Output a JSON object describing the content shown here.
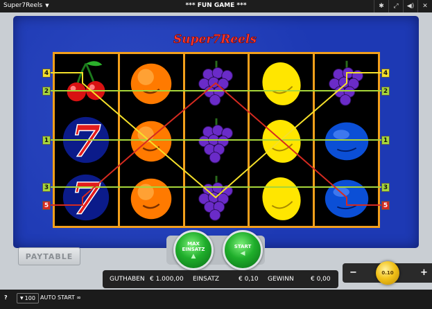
{
  "topbar": {
    "game_name": "Super7Reels",
    "mode": "*** FUN GAME ***",
    "icons": [
      "gear-icon",
      "fullscreen-icon",
      "sound-icon",
      "close-icon"
    ]
  },
  "logo": {
    "text": "Super7Reels"
  },
  "reels": [
    [
      "cherry",
      "seven",
      "seven"
    ],
    [
      "orange",
      "orange",
      "orange"
    ],
    [
      "grapes",
      "grapes",
      "grapes"
    ],
    [
      "lemon",
      "lemon",
      "lemon"
    ],
    [
      "grapes",
      "plum",
      "plum"
    ]
  ],
  "paylines": [
    {
      "number": "1",
      "color": "#a7d63a"
    },
    {
      "number": "2",
      "color": "#a7d63a"
    },
    {
      "number": "3",
      "color": "#a7d63a"
    },
    {
      "number": "4",
      "color": "#f5e02a"
    },
    {
      "number": "5",
      "color": "#d42a20"
    }
  ],
  "buttons": {
    "paytable": "PAYTABLE",
    "max_bet_line1": "MAX",
    "max_bet_line2": "EINSATZ",
    "start": "START"
  },
  "info_bar": {
    "balance_label": "GUTHABEN",
    "balance_value": "€ 1.000,00",
    "bet_label": "EINSATZ",
    "bet_value": "€ 0,10",
    "win_label": "GEWINN",
    "win_value": "€ 0,00"
  },
  "stake": {
    "minus": "−",
    "plus": "+",
    "value": "0.10"
  },
  "footer": {
    "help": "?",
    "autoplay_count": "100",
    "autostart": "AUTO START"
  },
  "colors": {
    "board": "#1d39b4",
    "reel_frame": "#f3a01b",
    "topbar": "#1d1d1d"
  }
}
